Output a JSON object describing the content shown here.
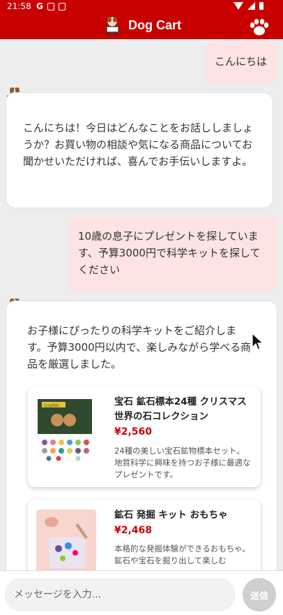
{
  "status_bar": {
    "time": "21:58",
    "carrier": "G"
  },
  "app_bar": {
    "title": "Dog Cart"
  },
  "messages": [
    {
      "role": "user",
      "text": "こんにちは"
    },
    {
      "role": "bot",
      "text": "こんにちは！今日はどんなことをお話ししましょうか？お買い物の相談や気になる商品についてお聞かせいただければ、喜んでお手伝いしますよ。"
    },
    {
      "role": "user",
      "text": "10歳の息子にプレゼントを探しています、予算3000円で科学キットを探してください"
    },
    {
      "role": "bot",
      "text": "お子様にぴったりの科学キットをご紹介します。予算3000円以内で、楽しみながら学べる商品を厳選しました。"
    }
  ],
  "products": [
    {
      "name": "宝石 鉱石標本24種 クリスマス 世界の石コレクション",
      "price": "¥2,560",
      "description": "24種の美しい宝石鉱物標本セット。地質科学に興味を持つお子様に最適なプレゼントです。",
      "image_label": "Crystal"
    },
    {
      "name": "鉱石 発掘 キット おもちゃ",
      "price": "¥2,468",
      "description": "本格的な発掘体験ができるおもちゃ。鉱石や宝石を掘り出して楽しむ"
    }
  ],
  "input": {
    "placeholder": "メッセージを入力..."
  },
  "send_button": {
    "label": "送信"
  },
  "colors": {
    "brand": "#c80000",
    "user_bubble": "#fde3e3",
    "price": "#d10000",
    "send_disabled": "#cfcfcf"
  }
}
